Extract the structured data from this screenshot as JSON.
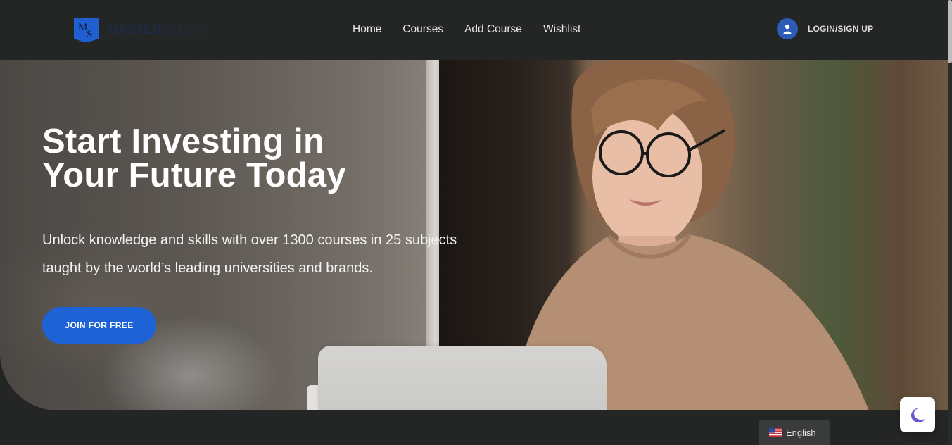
{
  "header": {
    "logo": {
      "mark_text": "MS",
      "text_bold": "MASTER",
      "text_light": "STUDY"
    },
    "nav": [
      {
        "label": "Home"
      },
      {
        "label": "Courses"
      },
      {
        "label": "Add Course"
      },
      {
        "label": "Wishlist"
      }
    ],
    "login": {
      "label": "LOGIN/SIGN UP",
      "icon": "user-icon"
    }
  },
  "hero": {
    "title_line1": "Start Investing in",
    "title_line2": "Your Future Today",
    "subtitle_line1": "Unlock knowledge and skills with over 1300 courses in 25 subjects",
    "subtitle_line2": "taught by the world’s leading universities and brands.",
    "cta_label": "JOIN FOR FREE",
    "image": "woman-with-laptop-photo"
  },
  "floating_controls": {
    "dark_mode_icon": "moon-icon"
  },
  "language": {
    "label": "English",
    "flag_icon": "us-flag-icon"
  },
  "colors": {
    "page_bg": "#242525",
    "accent_button": "#1e63d6",
    "login_avatar": "#2e5bb5",
    "moon": "#6a5ad6"
  }
}
